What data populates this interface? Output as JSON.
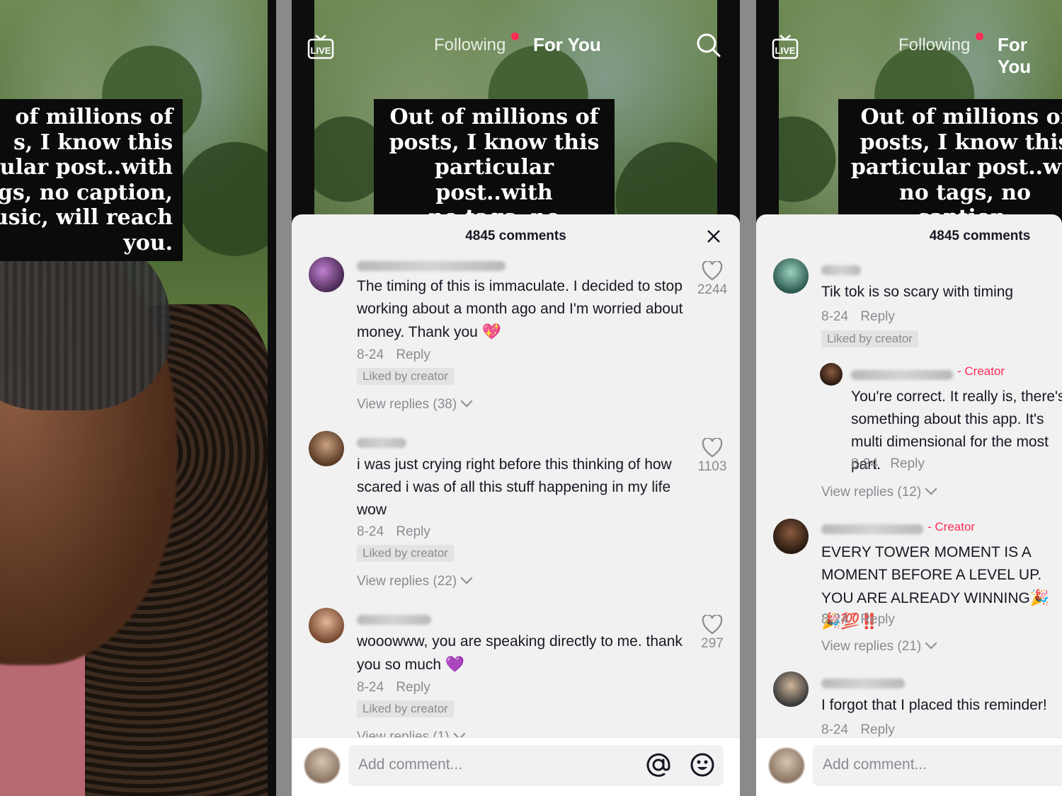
{
  "caption_full": "Out of millions of\nposts, I know this\nparticular post..with\nno tags, no caption,\nno music, will reach\nyou.",
  "left_caption": "of millions of\ns, I know this\nular post..with\ngs, no caption,\nusic, will reach\nyou.",
  "mid_caption": "Out of millions of\nposts, I know this\nparticular post..with\nno tags, no caption,\nno music, will reach",
  "right_caption": "Out of millions of\nposts, I know this\nparticular post..wit\nno tags, no caption,\nno music, will reach",
  "nav": {
    "following": "Following",
    "for_you": "For You",
    "live": "LIVE"
  },
  "sheet": {
    "title": "4845 comments",
    "add_comment_placeholder": "Add comment..."
  },
  "mid_comments": [
    {
      "text": "The timing of this is immaculate. I decided to stop working about a month ago and I'm worried about money. Thank you",
      "emoji": "💖",
      "date": "8-24",
      "reply": "Reply",
      "liked": "Liked by creator",
      "view_replies": "View replies (38)",
      "likes": "2244"
    },
    {
      "text": "i was just crying right before this thinking of how scared i was of all this stuff happening in my life wow",
      "date": "8-24",
      "reply": "Reply",
      "liked": "Liked by creator",
      "view_replies": "View replies (22)",
      "likes": "1103"
    },
    {
      "text": "wooowww, you are speaking directly to me. thank you so much",
      "emoji": "💜",
      "date": "8-24",
      "reply": "Reply",
      "liked": "Liked by creator",
      "view_replies": "View replies (1)",
      "likes": "297"
    }
  ],
  "right_comments": [
    {
      "text": "Tik tok is so scary with timing",
      "date": "8-24",
      "reply": "Reply",
      "liked": "Liked by creator"
    },
    {
      "creator_tag": "- Creator",
      "text": "You're correct. It really is, there's something about this app. It's multi dimensional for the most part.",
      "date": "8-24",
      "reply": "Reply",
      "view_replies": "View replies (12)"
    },
    {
      "creator_tag": "- Creator",
      "text": "EVERY TOWER MOMENT IS A MOMENT BEFORE A LEVEL UP. YOU ARE ALREADY WINNING",
      "emoji": "🎉🎉💯",
      "bang": "‼️",
      "date": "8-24",
      "reply": "Reply",
      "view_replies": "View replies (21)"
    },
    {
      "text": "I forgot that I placed this reminder!",
      "date": "8-24",
      "reply": "Reply"
    }
  ],
  "colors": {
    "accent": "#fe2c55",
    "sheet_bg": "#f1f1f1",
    "meta": "#8a8b91"
  }
}
